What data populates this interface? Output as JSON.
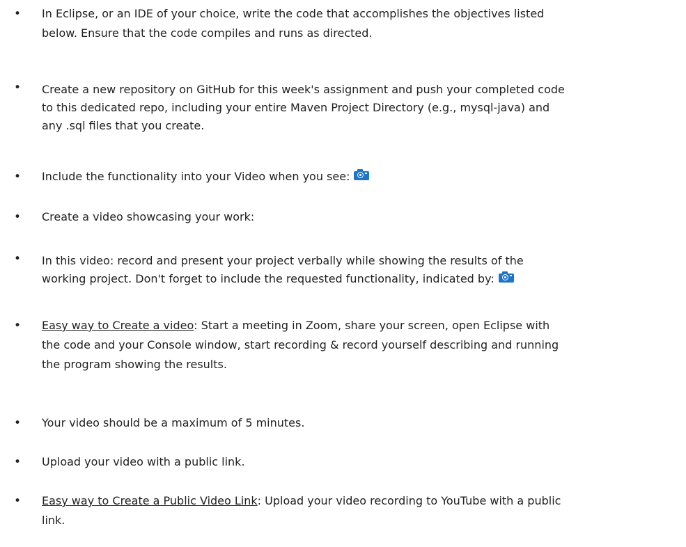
{
  "bullet_glyph": "•",
  "items": [
    {
      "id": "eclipse",
      "lines": [
        "In Eclipse, or an IDE of your choice, write the code that accomplishes the objectives listed",
        "below. Ensure that the code compiles and runs as directed."
      ]
    },
    {
      "id": "github",
      "lines": [
        "Create a new repository on GitHub for this week's assignment and push your completed code",
        "to this dedicated repo, including your entire Maven Project Directory (e.g., mysql-java) and",
        "any .sql files that you create."
      ]
    },
    {
      "id": "functionality",
      "text": "Include the functionality into your Video when you see:",
      "icon": "camera-icon"
    },
    {
      "id": "showcase",
      "text": "Create a video showcasing your work:"
    },
    {
      "id": "present",
      "line1": "In this video: record and present your project verbally while showing the results of the",
      "line2": "working project.   Don't forget to include the requested functionality, indicated by:",
      "icon": "camera-icon"
    },
    {
      "id": "easy-video",
      "label": "Easy way to Create a video",
      "rest": ":  Start a meeting in Zoom, share your screen, open Eclipse with",
      "lines": [
        "the code and your Console window, start recording & record yourself describing and running",
        "the program showing the results."
      ]
    },
    {
      "id": "max-length",
      "text": "Your video should be a maximum of 5 minutes."
    },
    {
      "id": "upload",
      "text": "Upload your video with a public link."
    },
    {
      "id": "easy-link",
      "label": "Easy way to Create a Public Video Link",
      "rest": ":  Upload your video recording to YouTube with a public",
      "lines": [
        "link."
      ]
    }
  ],
  "icon_color": "#1e74c8"
}
